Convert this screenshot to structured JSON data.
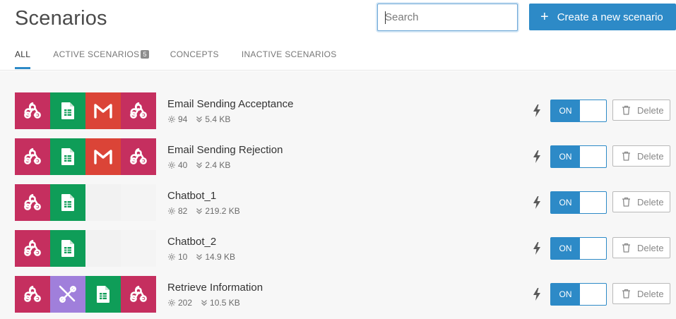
{
  "page": {
    "title": "Scenarios"
  },
  "search": {
    "placeholder": "Search"
  },
  "create_button": {
    "plus": "+",
    "label": "Create a new scenario"
  },
  "tabs": [
    {
      "label": "ALL",
      "active": true
    },
    {
      "label": "ACTIVE SCENARIOS",
      "badge": "5"
    },
    {
      "label": "CONCEPTS"
    },
    {
      "label": "INACTIVE SCENARIOS"
    }
  ],
  "colors": {
    "accent": "#2d8ac7",
    "webhook": "#c52f5f",
    "sheets": "#0f9d58",
    "gmail": "#db4437",
    "tools": "#a07fdb"
  },
  "scenarios": [
    {
      "name": "Email Sending Acceptance",
      "ops": "94",
      "size": "5.4 KB",
      "modules": [
        "webhook-icon",
        "google-sheets-icon",
        "gmail-icon",
        "webhook-icon"
      ],
      "toggle": "ON",
      "delete_label": "Delete"
    },
    {
      "name": "Email Sending Rejection",
      "ops": "40",
      "size": "2.4 KB",
      "modules": [
        "webhook-icon",
        "google-sheets-icon",
        "gmail-icon",
        "webhook-icon"
      ],
      "toggle": "ON",
      "delete_label": "Delete"
    },
    {
      "name": "Chatbot_1",
      "ops": "82",
      "size": "219.2 KB",
      "modules": [
        "webhook-icon",
        "google-sheets-icon"
      ],
      "toggle": "ON",
      "delete_label": "Delete"
    },
    {
      "name": "Chatbot_2",
      "ops": "10",
      "size": "14.9 KB",
      "modules": [
        "webhook-icon",
        "google-sheets-icon"
      ],
      "toggle": "ON",
      "delete_label": "Delete"
    },
    {
      "name": "Retrieve Information",
      "ops": "202",
      "size": "10.5 KB",
      "modules": [
        "webhook-icon",
        "tools-icon",
        "google-sheets-icon",
        "webhook-icon"
      ],
      "toggle": "ON",
      "delete_label": "Delete"
    }
  ]
}
